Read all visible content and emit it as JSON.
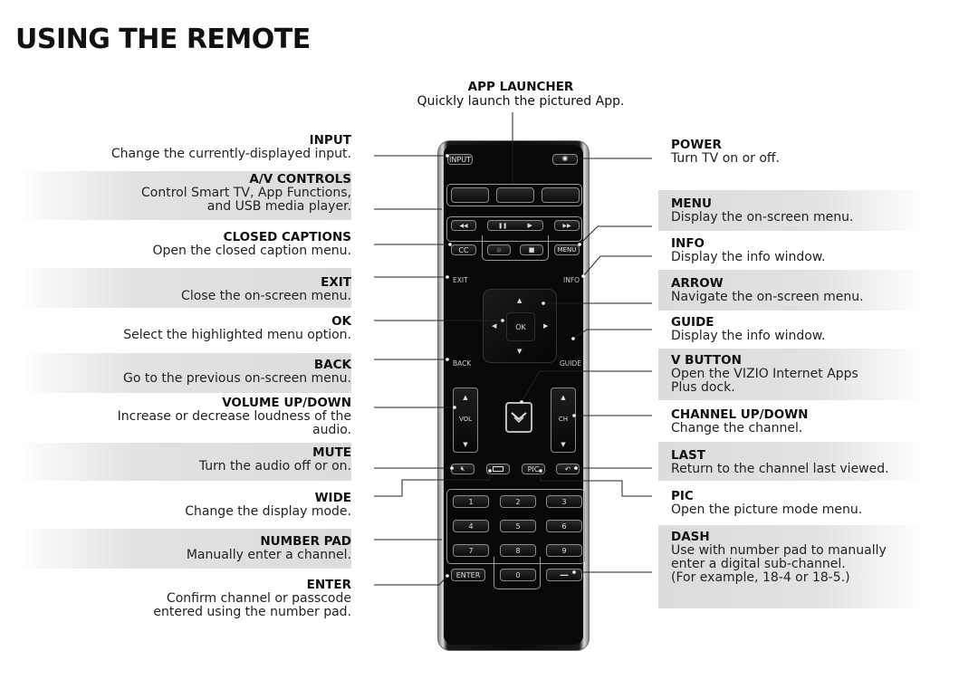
{
  "page": {
    "title": "USING THE REMOTE"
  },
  "app_launcher": {
    "title": "APP LAUNCHER",
    "description": "Quickly launch the pictured App."
  },
  "left_callouts": [
    {
      "title": "INPUT",
      "description": "Change the currently-displayed input.",
      "shaded": false
    },
    {
      "title": "A/V CONTROLS",
      "description": "Control Smart TV, App Functions,\nand USB media player.",
      "shaded": true
    },
    {
      "title": "CLOSED CAPTIONS",
      "description": "Open the closed caption menu.",
      "shaded": false
    },
    {
      "title": "EXIT",
      "description": "Close the on-screen menu.",
      "shaded": true
    },
    {
      "title": "OK",
      "description": "Select the highlighted menu option.",
      "shaded": false
    },
    {
      "title": "BACK",
      "description": "Go to the previous on-screen menu.",
      "shaded": true
    },
    {
      "title": "VOLUME UP/DOWN",
      "description": "Increase or decrease loudness of the\naudio.",
      "shaded": false
    },
    {
      "title": "MUTE",
      "description": "Turn the audio off or on.",
      "shaded": true
    },
    {
      "title": "WIDE",
      "description": "Change the display mode.",
      "shaded": false
    },
    {
      "title": "NUMBER PAD",
      "description": "Manually enter a channel.",
      "shaded": true
    },
    {
      "title": "ENTER",
      "description": "Confirm channel or passcode\nentered using the number pad.",
      "shaded": false
    }
  ],
  "right_callouts": [
    {
      "title": "POWER",
      "description": "Turn TV on or off.",
      "shaded": false
    },
    {
      "title": "MENU",
      "description": "Display the on-screen menu.",
      "shaded": true
    },
    {
      "title": "INFO",
      "description": "Display the info window.",
      "shaded": false
    },
    {
      "title": "ARROW",
      "description": "Navigate the on-screen menu.",
      "shaded": true
    },
    {
      "title": "GUIDE",
      "description": "Display the info window.",
      "shaded": false
    },
    {
      "title": "V BUTTON",
      "description": "Open the VIZIO Internet Apps\nPlus dock.",
      "shaded": true
    },
    {
      "title": "CHANNEL UP/DOWN",
      "description": "Change the channel.",
      "shaded": false
    },
    {
      "title": "LAST",
      "description": "Return to the channel last viewed.",
      "shaded": true
    },
    {
      "title": "PIC",
      "description": "Open the picture mode menu.",
      "shaded": false
    },
    {
      "title": "DASH",
      "description": "Use with number pad to manually\nenter a digital sub-channel.\n(For example, 18-4 or 18-5.)",
      "shaded": true
    }
  ],
  "remote": {
    "input_label": "INPUT",
    "power_icon": "power-icon",
    "cc_label": "CC",
    "menu_label": "MENU",
    "exit_label": "EXIT",
    "info_label": "INFO",
    "ok_label": "OK",
    "back_label": "BACK",
    "guide_label": "GUIDE",
    "vol_label": "VOL",
    "ch_label": "CH",
    "pic_label": "PIC",
    "enter_label": "ENTER",
    "transport": {
      "rewind": "◀◀",
      "pause": "❚❚",
      "play": "▶",
      "fast_forward": "▶▶",
      "record": "●",
      "stop": "■"
    },
    "arrows": {
      "up": "▲",
      "down": "▼",
      "left": "◀",
      "right": "▶"
    },
    "numbers": [
      "1",
      "2",
      "3",
      "4",
      "5",
      "6",
      "7",
      "8",
      "9",
      "0"
    ],
    "dash_symbol": "—"
  },
  "colors": {
    "band": "#dcdcdc",
    "remote_body": "#0b0b0b",
    "text": "#111111"
  }
}
